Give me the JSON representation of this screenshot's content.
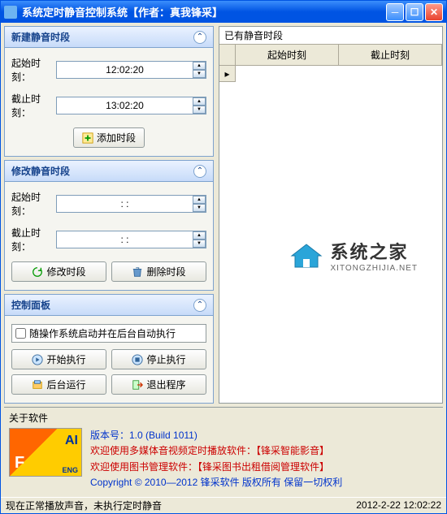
{
  "window": {
    "title": "系统定时静音控制系统【作者：真我锋采】"
  },
  "panels": {
    "new": {
      "title": "新建静音时段",
      "start_label": "起始时刻：",
      "end_label": "截止时刻：",
      "start_value": "12:02:20",
      "end_value": "13:02:20",
      "add_btn": "添加时段"
    },
    "edit": {
      "title": "修改静音时段",
      "start_label": "起始时刻：",
      "end_label": "截止时刻：",
      "start_value": ": :",
      "end_value": ": :",
      "modify_btn": "修改时段",
      "delete_btn": "删除时段"
    },
    "control": {
      "title": "控制面板",
      "checkbox_label": "随操作系统启动并在后台自动执行",
      "start_btn": "开始执行",
      "stop_btn": "停止执行",
      "background_btn": "后台运行",
      "exit_btn": "退出程序"
    }
  },
  "grid": {
    "title": "已有静音时段",
    "col_start": "起始时刻",
    "col_end": "截止时刻"
  },
  "about": {
    "title": "关于软件",
    "logo_text": "AI",
    "logo_sub": "ENG",
    "version": "版本号：1.0 (Build 1011)",
    "line1_prefix": "欢迎使用多媒体音视频定时播放软件：",
    "line1_product": "【锋采智能影音】",
    "line2_prefix": "欢迎使用图书管理软件：",
    "line2_product": "【锋采图书出租借阅管理软件】",
    "copyright": "Copyright © 2010—2012 锋采软件 版权所有 保留一切权利"
  },
  "statusbar": {
    "left": "现在正常播放声音，未执行定时静音",
    "right": "2012-2-22 12:02:22"
  },
  "watermark": {
    "cn": "系统之家",
    "en": "XITONGZHIJIA.NET"
  }
}
